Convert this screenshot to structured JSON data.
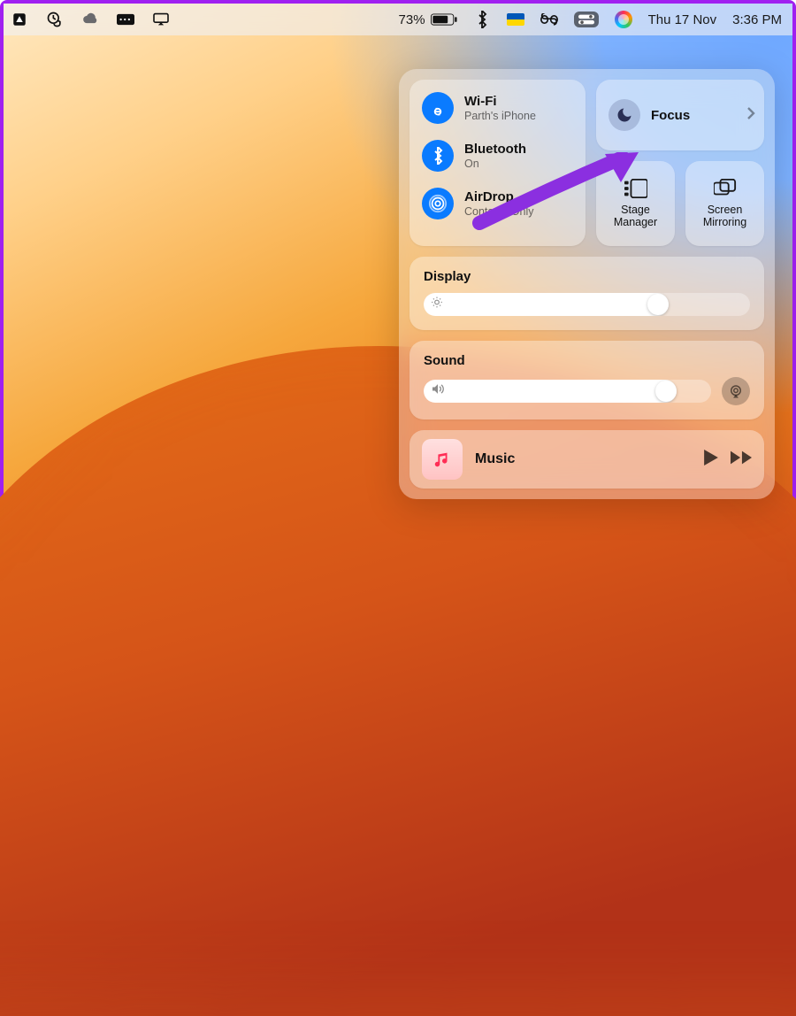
{
  "menubar": {
    "battery_percent": "73%",
    "date": "Thu 17 Nov",
    "time": "3:36 PM"
  },
  "controlcenter": {
    "wifi": {
      "label": "Wi-Fi",
      "status": "Parth's iPhone"
    },
    "bluetooth": {
      "label": "Bluetooth",
      "status": "On"
    },
    "airdrop": {
      "label": "AirDrop",
      "status": "Contacts Only"
    },
    "focus": {
      "label": "Focus"
    },
    "stage_manager": {
      "label": "Stage\nManager"
    },
    "screen_mirroring": {
      "label": "Screen\nMirroring"
    },
    "display": {
      "label": "Display",
      "value_pct": 75
    },
    "sound": {
      "label": "Sound",
      "value_pct": 88
    },
    "music": {
      "label": "Music"
    }
  },
  "colors": {
    "accent_blue": "#0a7bff",
    "arrow": "#8b2fe0"
  }
}
